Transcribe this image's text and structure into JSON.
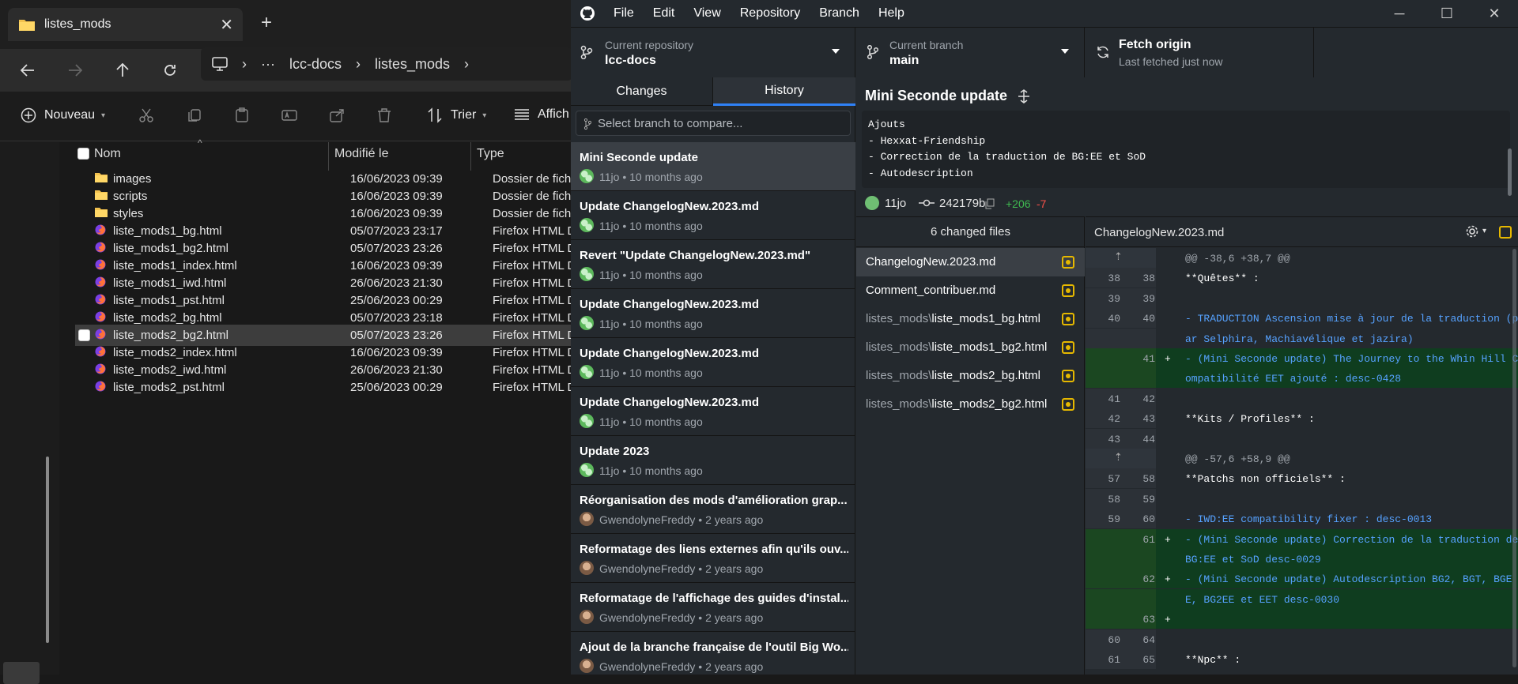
{
  "explorer": {
    "tab_title": "listes_mods",
    "close_glyph": "✕",
    "newtab_glyph": "+",
    "breadcrumb": [
      "lcc-docs",
      "listes_mods"
    ],
    "toolbar": {
      "new_label": "Nouveau",
      "sort_label": "Trier",
      "view_label": "Affich"
    },
    "columns": {
      "name": "Nom",
      "modified": "Modifié le",
      "type": "Type"
    },
    "files": [
      {
        "name": "images",
        "date": "16/06/2023 09:39",
        "type": "Dossier de fichiers",
        "kind": "folder"
      },
      {
        "name": "scripts",
        "date": "16/06/2023 09:39",
        "type": "Dossier de fichiers",
        "kind": "folder"
      },
      {
        "name": "styles",
        "date": "16/06/2023 09:39",
        "type": "Dossier de fichiers",
        "kind": "folder"
      },
      {
        "name": "liste_mods1_bg.html",
        "date": "05/07/2023 23:17",
        "type": "Firefox HTML Doc",
        "kind": "html"
      },
      {
        "name": "liste_mods1_bg2.html",
        "date": "05/07/2023 23:26",
        "type": "Firefox HTML Doc",
        "kind": "html"
      },
      {
        "name": "liste_mods1_index.html",
        "date": "16/06/2023 09:39",
        "type": "Firefox HTML Doc",
        "kind": "html"
      },
      {
        "name": "liste_mods1_iwd.html",
        "date": "26/06/2023 21:30",
        "type": "Firefox HTML Doc",
        "kind": "html"
      },
      {
        "name": "liste_mods1_pst.html",
        "date": "25/06/2023 00:29",
        "type": "Firefox HTML Doc",
        "kind": "html"
      },
      {
        "name": "liste_mods2_bg.html",
        "date": "05/07/2023 23:18",
        "type": "Firefox HTML Doc",
        "kind": "html"
      },
      {
        "name": "liste_mods2_bg2.html",
        "date": "05/07/2023 23:26",
        "type": "Firefox HTML Doc",
        "kind": "html",
        "selected": true
      },
      {
        "name": "liste_mods2_index.html",
        "date": "16/06/2023 09:39",
        "type": "Firefox HTML Doc",
        "kind": "html"
      },
      {
        "name": "liste_mods2_iwd.html",
        "date": "26/06/2023 21:30",
        "type": "Firefox HTML Doc",
        "kind": "html"
      },
      {
        "name": "liste_mods2_pst.html",
        "date": "25/06/2023 00:29",
        "type": "Firefox HTML Doc",
        "kind": "html"
      }
    ]
  },
  "github": {
    "menu": [
      "File",
      "Edit",
      "View",
      "Repository",
      "Branch",
      "Help"
    ],
    "repo": {
      "label": "Current repository",
      "value": "lcc-docs"
    },
    "branch": {
      "label": "Current branch",
      "value": "main"
    },
    "fetch": {
      "label": "Fetch origin",
      "sub": "Last fetched just now"
    },
    "tabs": {
      "changes": "Changes",
      "history": "History"
    },
    "branch_placeholder": "Select branch to compare...",
    "commits": [
      {
        "title": "Mini Seconde update",
        "meta": "11jo • 10 months ago",
        "avatar": "green",
        "selected": true
      },
      {
        "title": "Update ChangelogNew.2023.md",
        "meta": "11jo • 10 months ago",
        "avatar": "green"
      },
      {
        "title": "Revert \"Update ChangelogNew.2023.md\"",
        "meta": "11jo • 10 months ago",
        "avatar": "green"
      },
      {
        "title": "Update ChangelogNew.2023.md",
        "meta": "11jo • 10 months ago",
        "avatar": "green"
      },
      {
        "title": "Update ChangelogNew.2023.md",
        "meta": "11jo • 10 months ago",
        "avatar": "green"
      },
      {
        "title": "Update ChangelogNew.2023.md",
        "meta": "11jo • 10 months ago",
        "avatar": "green"
      },
      {
        "title": "Update 2023",
        "meta": "11jo • 10 months ago",
        "avatar": "green"
      },
      {
        "title": "Réorganisation des mods d'amélioration grap...",
        "meta": "GwendolyneFreddy • 2 years ago",
        "avatar": "photo"
      },
      {
        "title": "Reformatage des liens externes afin qu'ils ouv...",
        "meta": "GwendolyneFreddy • 2 years ago",
        "avatar": "photo"
      },
      {
        "title": "Reformatage de l'affichage des guides d'instal...",
        "meta": "GwendolyneFreddy • 2 years ago",
        "avatar": "photo"
      },
      {
        "title": "Ajout de la branche française de l'outil Big Wo...",
        "meta": "GwendolyneFreddy • 2 years ago",
        "avatar": "photo"
      }
    ],
    "commit_detail": {
      "title": "Mini Seconde update",
      "body": [
        "Ajouts",
        "- Hexxat-Friendship",
        "- Correction de la traduction de BG:EE et SoD",
        "- Autodescription"
      ],
      "author": "11jo",
      "sha": "242179b",
      "additions": "+206",
      "deletions": "-7"
    },
    "files_header": "6 changed files",
    "files": [
      {
        "dir": "",
        "name": "ChangelogNew.2023.md",
        "selected": true
      },
      {
        "dir": "",
        "name": "Comment_contribuer.md"
      },
      {
        "dir": "listes_mods\\",
        "name": "liste_mods1_bg.html"
      },
      {
        "dir": "listes_mods\\",
        "name": "liste_mods1_bg2.html"
      },
      {
        "dir": "listes_mods\\",
        "name": "liste_mods2_bg.html"
      },
      {
        "dir": "listes_mods\\",
        "name": "liste_mods2_bg2.html"
      }
    ],
    "diff_file": "ChangelogNew.2023.md",
    "diff": [
      {
        "kind": "hunk",
        "o": "",
        "n": "",
        "text": "@@ -38,6 +38,7 @@"
      },
      {
        "kind": "ctx",
        "o": "38",
        "n": "38",
        "text": "**Quêtes** :"
      },
      {
        "kind": "ctx",
        "o": "39",
        "n": "39",
        "text": ""
      },
      {
        "kind": "ctx",
        "o": "40",
        "n": "40",
        "text": "- TRADUCTION Ascension mise à jour de la traduction (p",
        "blue": true
      },
      {
        "kind": "ctxw",
        "o": "",
        "n": "",
        "text": "ar Selphira, Machiavélique et jazira)",
        "blue": true
      },
      {
        "kind": "add",
        "o": "",
        "n": "41",
        "text": "- (Mini Seconde update) The Journey to the Whin Hill C",
        "blue": true
      },
      {
        "kind": "addw",
        "o": "",
        "n": "",
        "text": "ompatibilité EET ajouté : desc-0428",
        "blue": true
      },
      {
        "kind": "ctx",
        "o": "41",
        "n": "42",
        "text": ""
      },
      {
        "kind": "ctx",
        "o": "42",
        "n": "43",
        "text": "**Kits / Profiles** :"
      },
      {
        "kind": "ctx",
        "o": "43",
        "n": "44",
        "text": ""
      },
      {
        "kind": "hunk",
        "o": "",
        "n": "",
        "text": "@@ -57,6 +58,9 @@"
      },
      {
        "kind": "ctx",
        "o": "57",
        "n": "58",
        "text": "**Patchs non officiels** :"
      },
      {
        "kind": "ctx",
        "o": "58",
        "n": "59",
        "text": ""
      },
      {
        "kind": "ctx",
        "o": "59",
        "n": "60",
        "text": "- IWD:EE compatibility fixer : desc-0013",
        "blue": true
      },
      {
        "kind": "add",
        "o": "",
        "n": "61",
        "text": "- (Mini Seconde update) Correction de la traduction de",
        "blue": true
      },
      {
        "kind": "addw",
        "o": "",
        "n": "",
        "text": "BG:EE et SoD desc-0029",
        "blue": true
      },
      {
        "kind": "add",
        "o": "",
        "n": "62",
        "text": "- (Mini Seconde update) Autodescription BG2, BGT, BGE",
        "blue": true
      },
      {
        "kind": "addw",
        "o": "",
        "n": "",
        "text": "E, BG2EE et EET desc-0030",
        "blue": true
      },
      {
        "kind": "add",
        "o": "",
        "n": "63",
        "text": ""
      },
      {
        "kind": "ctx",
        "o": "60",
        "n": "64",
        "text": ""
      },
      {
        "kind": "ctx",
        "o": "61",
        "n": "65",
        "text": "**Npc** :"
      }
    ]
  }
}
